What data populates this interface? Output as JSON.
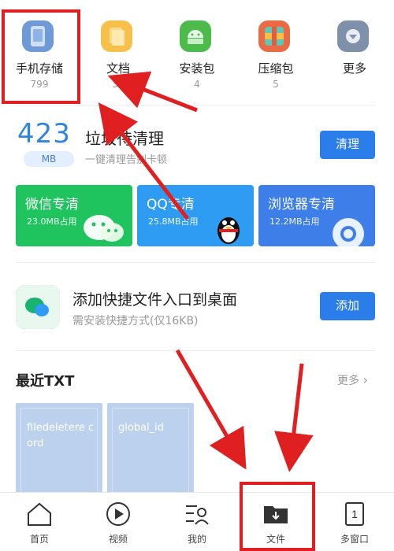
{
  "categories": [
    {
      "label": "手机存储",
      "count": "799",
      "icon": "phone-storage-icon",
      "color": "#5b8ed6"
    },
    {
      "label": "文档",
      "count": "30",
      "icon": "document-icon",
      "color": "#f6b93b"
    },
    {
      "label": "安装包",
      "count": "4",
      "icon": "android-icon",
      "color": "#4cbb4c"
    },
    {
      "label": "压缩包",
      "count": "5",
      "icon": "archive-icon",
      "color": "#e55b3c"
    },
    {
      "label": "更多",
      "count": "",
      "icon": "more-icon",
      "color": "#7f90aa"
    }
  ],
  "junk": {
    "size": "423",
    "unit": "MB",
    "title": "垃圾待清理",
    "subtitle": "一键清理告别卡顿",
    "button": "清理"
  },
  "clean_cards": [
    {
      "title": "微信专清",
      "sub": "23.0MB占用",
      "color": "#1fc45f"
    },
    {
      "title": "QQ专清",
      "sub": "25.8MB占用",
      "color": "#2e9cf3"
    },
    {
      "title": "浏览器专清",
      "sub": "12.2MB占用",
      "color": "#3d7ee8"
    }
  ],
  "shortcut": {
    "title": "添加快捷文件入口到桌面",
    "subtitle": "需安装快捷方式(仅16KB)",
    "button": "添加"
  },
  "recent": {
    "title": "最近TXT",
    "more": "更多",
    "files": [
      "filedeletere cord",
      "global_id"
    ]
  },
  "nav": [
    {
      "label": "首页",
      "icon": "home-icon"
    },
    {
      "label": "视频",
      "icon": "video-icon"
    },
    {
      "label": "我的",
      "icon": "profile-icon"
    },
    {
      "label": "文件",
      "icon": "folder-download-icon"
    },
    {
      "label": "多窗口",
      "icon": "multi-window-icon"
    }
  ],
  "accent": "#2b7de9",
  "annotation_color": "#e02020"
}
